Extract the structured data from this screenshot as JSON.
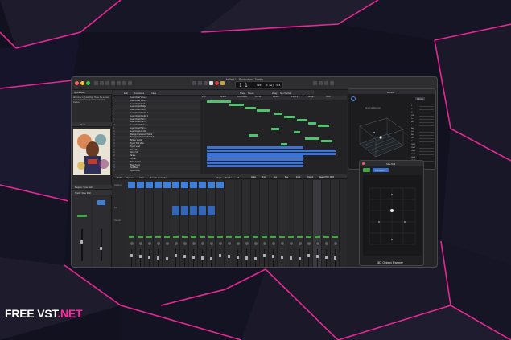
{
  "window": {
    "title": "Untitled 1 - Production - Tracks",
    "lcd_bar": "1",
    "lcd_beat": "1",
    "lcd_tempo": "120",
    "lcd_key": "C maj",
    "lcd_sig": "4/4"
  },
  "quick_help": {
    "title": "Quick Help",
    "text": "Welcome to Quick Help. Move the pointer over an item to learn its function and shortcut."
  },
  "media": {
    "title": "Media"
  },
  "tracks_menu": {
    "edit": "Edit",
    "functions": "Functions",
    "view": "View",
    "snap_label": "Snap:",
    "snap_value": "Smart",
    "drag_label": "Drag:",
    "drag_value": "No Overlap"
  },
  "tracks": [
    "Lead Vocal Verse 1",
    "Lead Vocal Verse 2",
    "Lead Vocal Chorus",
    "Lead Vocal Bridge",
    "Lead Vocal Outro",
    "Lead Vocal Double 1",
    "Lead Vocal Double 2",
    "Lead Vocal Harm 1",
    "Lead Vocal Harm 2",
    "Lead Vocal Harm 3",
    "Lead Vocal Harm 4",
    "Lead Vocal Ad Lib",
    "Backgrounds Vocal Stack",
    "Backgrounds Vocal Stack 2",
    "Bridge Vocals",
    "Synth Pad Main",
    "Synth Lead",
    "Drum Bus",
    "Drum Kit",
    "Snare",
    "Hi-Hat",
    "Bass Guitar",
    "Bass Synth",
    "Sub Bass",
    "Room Verb"
  ],
  "arrange_markers": [
    "Intro",
    "Verse 1",
    "Pre-Chorus",
    "Chorus 1",
    "Verse 2",
    "Chorus 2",
    "Bridge",
    "Outro"
  ],
  "mixer_menu": {
    "edit": "Edit",
    "options": "Options",
    "view": "View",
    "sends_on_faders": "Sends on Faders",
    "single": "Single",
    "tracks": "Tracks",
    "all": "All",
    "filters": [
      "Audio",
      "Inst",
      "Aux",
      "Bus",
      "Input",
      "Output",
      "Master/VCA",
      "MIDI"
    ]
  },
  "mixer_labels": {
    "setting": "Setting",
    "eq": "EQ",
    "sends": "Sends",
    "stereo_out": "Stereo Out",
    "read": "Read"
  },
  "inspector": {
    "region": "Region: Sine Roll",
    "track": "Track: Sine Roll"
  },
  "meter_window": {
    "title": "Monitor",
    "tab": "Atmos",
    "label": "Binaural Render",
    "right_list": [
      "L",
      "R",
      "C",
      "LFE",
      "Ls",
      "Rs",
      "Lrs",
      "Rrs",
      "Ltf",
      "Rtf",
      "Ltr",
      "Rtr",
      "Obj 1",
      "Obj 2",
      "Obj 3",
      "Obj 4",
      "Obj 5",
      "Obj 6"
    ]
  },
  "panner_window": {
    "title": "Sine Roll",
    "mode": "Compare",
    "footer_label": "3D Object Panner"
  },
  "brand": {
    "main": "FREE VST",
    "suffix": ".NET"
  },
  "colors": {
    "accent": "#ff2aa0",
    "region_green": "#53c26e",
    "region_blue": "#3b73d6",
    "plugin_blue": "#3f7fd6",
    "button_green": "#46a349",
    "record_red": "#e0383a"
  },
  "icons": [
    "search-icon",
    "gear-icon",
    "play-icon",
    "record-icon",
    "rewind-icon",
    "forward-icon",
    "stop-icon",
    "cycle-icon"
  ]
}
